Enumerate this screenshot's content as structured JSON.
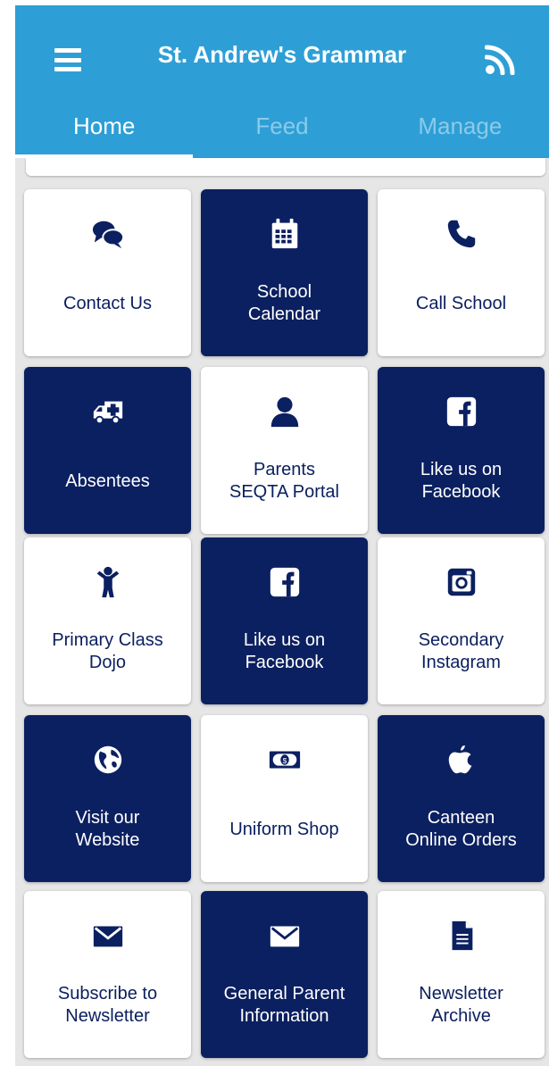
{
  "header": {
    "title": "St. Andrew's Grammar",
    "menu_icon": "hamburger-menu-icon",
    "feed_icon": "rss-icon",
    "background": "#2d9fd6"
  },
  "tabs": [
    {
      "label": "Home",
      "active": true
    },
    {
      "label": "Feed",
      "active": false
    },
    {
      "label": "Manage",
      "active": false
    }
  ],
  "colors": {
    "navy": "#0b2060",
    "white": "#ffffff",
    "page_bg": "#e6e6e6"
  },
  "tiles": [
    {
      "label": "Contact Us",
      "icon": "chat-bubbles-icon",
      "style": "light"
    },
    {
      "label": "School\nCalendar",
      "icon": "calendar-icon",
      "style": "dark"
    },
    {
      "label": "Call School",
      "icon": "phone-icon",
      "style": "light"
    },
    {
      "label": "Absentees",
      "icon": "ambulance-icon",
      "style": "dark"
    },
    {
      "label": "Parents\nSEQTA Portal",
      "icon": "user-icon",
      "style": "light"
    },
    {
      "label": "Like us on\nFacebook",
      "icon": "facebook-icon",
      "style": "dark"
    },
    {
      "label": "Primary Class\nDojo",
      "icon": "child-icon",
      "style": "light"
    },
    {
      "label": "Like us on\nFacebook",
      "icon": "facebook-icon",
      "style": "dark"
    },
    {
      "label": "Secondary\nInstagram",
      "icon": "instagram-icon",
      "style": "light"
    },
    {
      "label": "Visit our\nWebsite",
      "icon": "globe-icon",
      "style": "dark"
    },
    {
      "label": "Uniform Shop",
      "icon": "money-icon",
      "style": "light"
    },
    {
      "label": "Canteen\nOnline Orders",
      "icon": "apple-icon",
      "style": "dark"
    },
    {
      "label": "Subscribe to\nNewsletter",
      "icon": "envelope-icon",
      "style": "light"
    },
    {
      "label": "General Parent\nInformation",
      "icon": "envelope-icon",
      "style": "dark"
    },
    {
      "label": "Newsletter\nArchive",
      "icon": "document-icon",
      "style": "light"
    }
  ]
}
